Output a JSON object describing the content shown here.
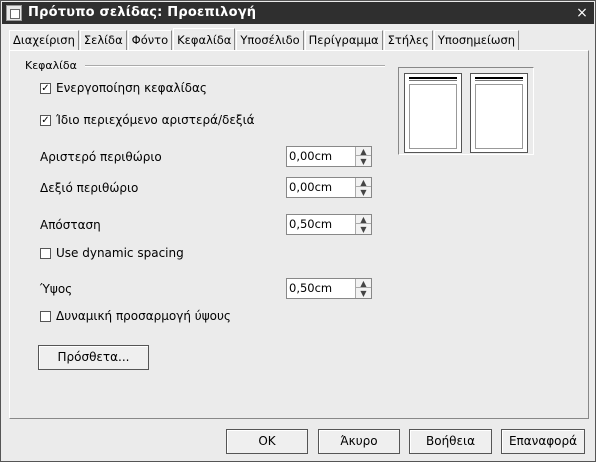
{
  "window": {
    "title": "Πρότυπο σελίδας: Προεπιλογή"
  },
  "tabs": [
    {
      "label": "Διαχείριση"
    },
    {
      "label": "Σελίδα"
    },
    {
      "label": "Φόντο"
    },
    {
      "label": "Κεφαλίδα"
    },
    {
      "label": "Υποσέλιδο"
    },
    {
      "label": "Περίγραμμα"
    },
    {
      "label": "Στήλες"
    },
    {
      "label": "Υποσημείωση"
    }
  ],
  "active_tab": "Κεφαλίδα",
  "header_group": {
    "title": "Κεφαλίδα",
    "enable_header": {
      "label": "Ενεργοποίηση κεφαλίδας",
      "checked": true
    },
    "same_content": {
      "label": "Ίδιο περιεχόμενο αριστερά/δεξιά",
      "checked": true
    },
    "left_margin": {
      "label": "Αριστερό περιθώριο",
      "value": "0,00cm"
    },
    "right_margin": {
      "label": "Δεξιό περιθώριο",
      "value": "0,00cm"
    },
    "spacing": {
      "label": "Απόσταση",
      "value": "0,50cm"
    },
    "dynamic_spacing": {
      "label": "Use dynamic spacing",
      "checked": false
    },
    "height": {
      "label": "Ύψος",
      "value": "0,50cm"
    },
    "autofit_height": {
      "label": "Δυναμική προσαρμογή ύψους",
      "checked": false
    },
    "more_button": "Πρόσθετα..."
  },
  "footer_buttons": {
    "ok": "OK",
    "cancel": "Άκυρο",
    "help": "Βοήθεια",
    "reset": "Επαναφορά"
  },
  "icons": {
    "checked_mark": "✓",
    "close": "×",
    "spin_up": "▲",
    "spin_down": "▼"
  }
}
